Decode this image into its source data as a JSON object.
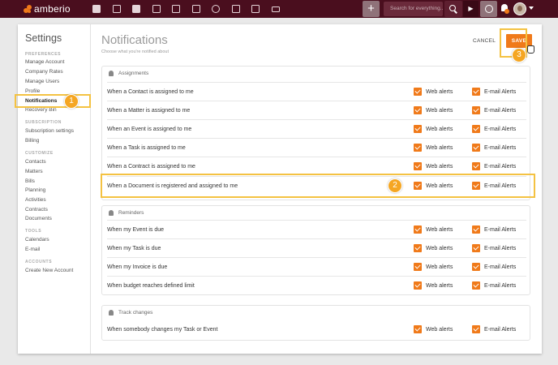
{
  "topbar": {
    "logo_text": "amberio",
    "search_placeholder": "Search for everything...",
    "plus_label": "+",
    "play_label": "▶",
    "nav_icons": [
      "dashboard-icon",
      "contacts-icon",
      "matters-icon",
      "bills-icon",
      "court-icon",
      "calendar-icon",
      "time-icon",
      "folder-icon",
      "documents-icon",
      "email-icon"
    ],
    "colors": {
      "bar": "#4a0e1e",
      "accent": "#f07a1a"
    }
  },
  "sidebar": {
    "title": "Settings",
    "sections": [
      {
        "heading": "PREFERENCES",
        "items": [
          "Manage Account",
          "Company Rates",
          "Manage Users",
          "Profile",
          "Notifications",
          "Recovery Bin"
        ]
      },
      {
        "heading": "SUBSCRIPTION",
        "items": [
          "Subscription settings",
          "Billing"
        ]
      },
      {
        "heading": "CUSTOMIZE",
        "items": [
          "Contacts",
          "Matters",
          "Bills",
          "Planning",
          "Activities",
          "Contracts",
          "Documents"
        ]
      },
      {
        "heading": "TOOLS",
        "items": [
          "Calendars",
          "E-mail"
        ]
      },
      {
        "heading": "ACCOUNTS",
        "items": [
          "Create New Account"
        ]
      }
    ],
    "active_item": "Notifications"
  },
  "main": {
    "title": "Notifications",
    "subtitle": "Choose what you're notified about",
    "cancel_label": "CANCEL",
    "save_label": "SAVE",
    "web_label": "Web alerts",
    "email_label": "E-mail Alerts",
    "sections": [
      {
        "heading": "Assignments",
        "rows": [
          {
            "label": "When a Contact is assigned to me",
            "web": true,
            "email": true
          },
          {
            "label": "When a Matter is assigned to me",
            "web": true,
            "email": true
          },
          {
            "label": "When an Event is assigned to me",
            "web": true,
            "email": true
          },
          {
            "label": "When a Task is assigned to me",
            "web": true,
            "email": true
          },
          {
            "label": "When a Contract is assigned to me",
            "web": true,
            "email": true
          },
          {
            "label": "When a Document is registered and assigned to me",
            "web": true,
            "email": true
          }
        ]
      },
      {
        "heading": "Reminders",
        "rows": [
          {
            "label": "When my Event is due",
            "web": true,
            "email": true
          },
          {
            "label": "When my Task is due",
            "web": true,
            "email": true
          },
          {
            "label": "When my Invoice is due",
            "web": true,
            "email": true
          },
          {
            "label": "When budget reaches defined limit",
            "web": true,
            "email": true
          }
        ]
      },
      {
        "heading": "Track changes",
        "rows": [
          {
            "label": "When somebody changes my Task or Event",
            "web": true,
            "email": true
          }
        ]
      }
    ]
  },
  "tutorial": {
    "badges": [
      "1",
      "2",
      "3"
    ],
    "highlight_color": "#f4c242"
  }
}
